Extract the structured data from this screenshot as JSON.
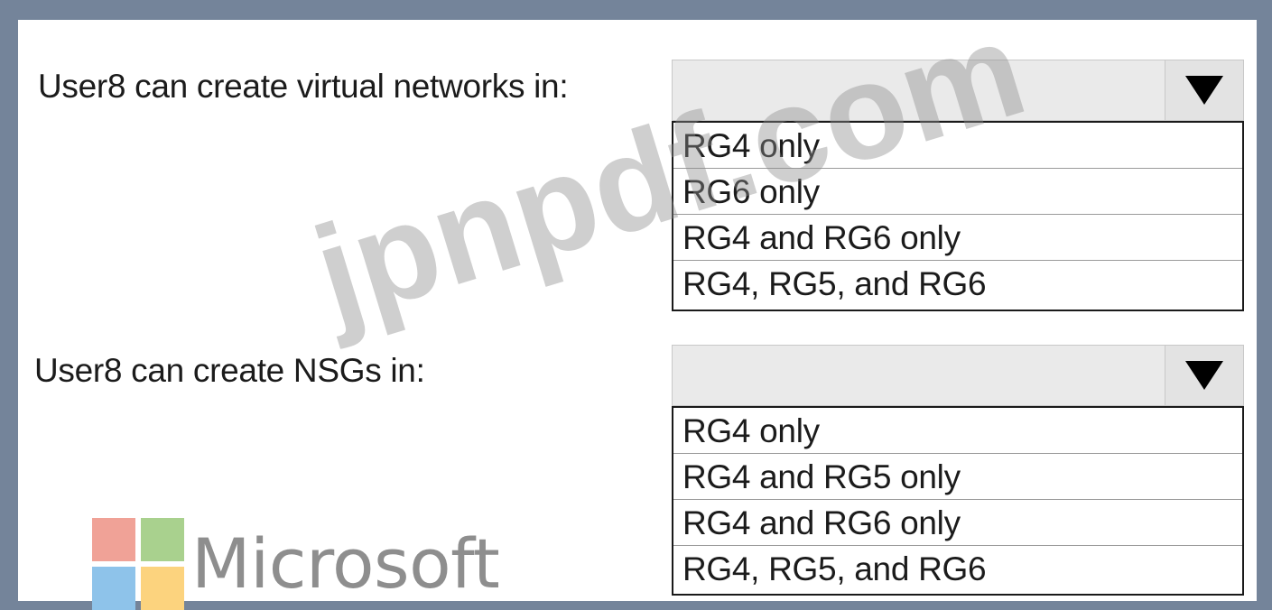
{
  "questions": [
    {
      "label": "User8 can create virtual networks in:",
      "selected": "",
      "options": [
        "RG4 only",
        "RG6 only",
        "RG4 and RG6 only",
        "RG4, RG5, and RG6"
      ]
    },
    {
      "label": "User8 can create NSGs in:",
      "selected": "",
      "options": [
        "RG4 only",
        "RG4 and RG5 only",
        "RG4 and RG6 only",
        "RG4, RG5, and RG6"
      ]
    }
  ],
  "watermark": "jpnpdf.com",
  "logo": {
    "text": "Microsoft"
  },
  "colors": {
    "frame": "#74849a",
    "logo_red": "#f0a297",
    "logo_green": "#a9d18e",
    "logo_blue": "#8ec3ea",
    "logo_yellow": "#fcd37e"
  },
  "icons": {
    "dropdown": "triangle-down-icon"
  }
}
